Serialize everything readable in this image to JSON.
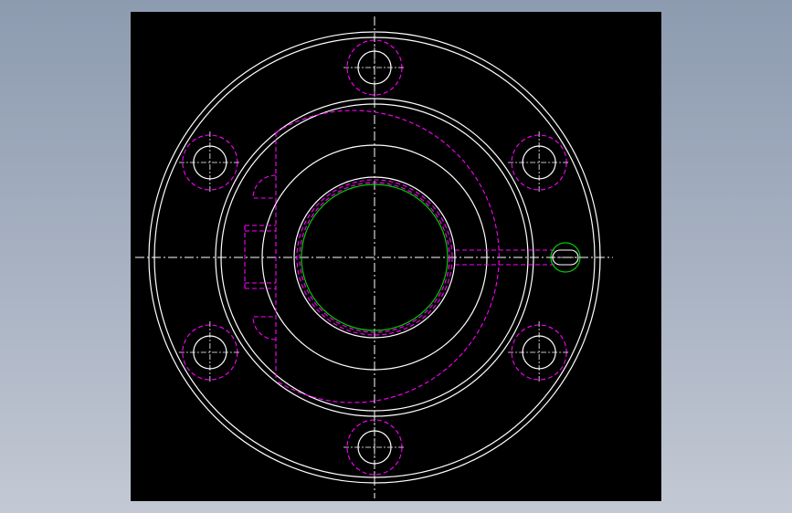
{
  "window": {
    "background_top": "#8d9bb0",
    "background_bottom": "#c3c9d4"
  },
  "viewport": {
    "background": "#000000"
  },
  "drawing": {
    "colors": {
      "outline": "#ffffff",
      "hidden": "#ff00ff",
      "centerline": "#ffffff",
      "bore": "#00cc00"
    },
    "views": "flange-front-view",
    "bolt_hole_count": 6,
    "has_side_lug": true,
    "has_locating_pin": true
  }
}
